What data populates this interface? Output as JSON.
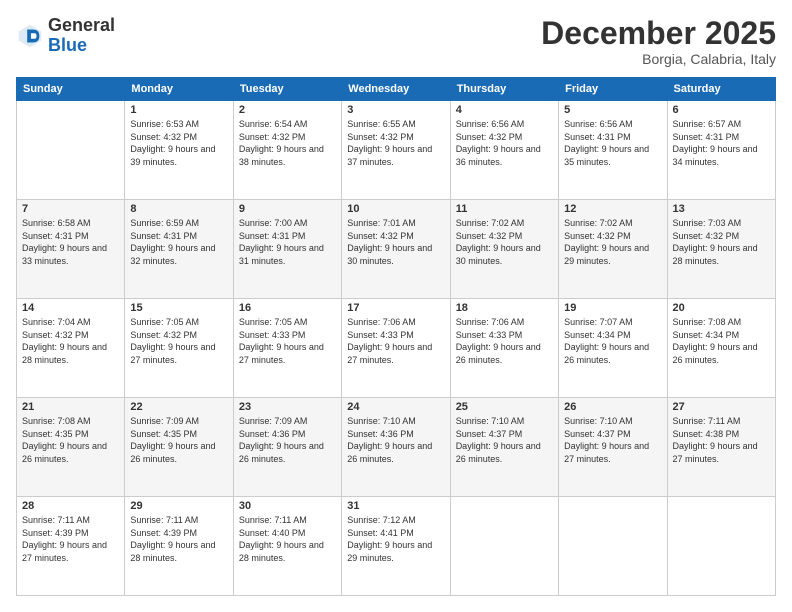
{
  "logo": {
    "general": "General",
    "blue": "Blue"
  },
  "header": {
    "month_title": "December 2025",
    "location": "Borgia, Calabria, Italy"
  },
  "weekdays": [
    "Sunday",
    "Monday",
    "Tuesday",
    "Wednesday",
    "Thursday",
    "Friday",
    "Saturday"
  ],
  "weeks": [
    [
      {
        "day": "",
        "sunrise": "",
        "sunset": "",
        "daylight": ""
      },
      {
        "day": "1",
        "sunrise": "Sunrise: 6:53 AM",
        "sunset": "Sunset: 4:32 PM",
        "daylight": "Daylight: 9 hours and 39 minutes."
      },
      {
        "day": "2",
        "sunrise": "Sunrise: 6:54 AM",
        "sunset": "Sunset: 4:32 PM",
        "daylight": "Daylight: 9 hours and 38 minutes."
      },
      {
        "day": "3",
        "sunrise": "Sunrise: 6:55 AM",
        "sunset": "Sunset: 4:32 PM",
        "daylight": "Daylight: 9 hours and 37 minutes."
      },
      {
        "day": "4",
        "sunrise": "Sunrise: 6:56 AM",
        "sunset": "Sunset: 4:32 PM",
        "daylight": "Daylight: 9 hours and 36 minutes."
      },
      {
        "day": "5",
        "sunrise": "Sunrise: 6:56 AM",
        "sunset": "Sunset: 4:31 PM",
        "daylight": "Daylight: 9 hours and 35 minutes."
      },
      {
        "day": "6",
        "sunrise": "Sunrise: 6:57 AM",
        "sunset": "Sunset: 4:31 PM",
        "daylight": "Daylight: 9 hours and 34 minutes."
      }
    ],
    [
      {
        "day": "7",
        "sunrise": "Sunrise: 6:58 AM",
        "sunset": "Sunset: 4:31 PM",
        "daylight": "Daylight: 9 hours and 33 minutes."
      },
      {
        "day": "8",
        "sunrise": "Sunrise: 6:59 AM",
        "sunset": "Sunset: 4:31 PM",
        "daylight": "Daylight: 9 hours and 32 minutes."
      },
      {
        "day": "9",
        "sunrise": "Sunrise: 7:00 AM",
        "sunset": "Sunset: 4:31 PM",
        "daylight": "Daylight: 9 hours and 31 minutes."
      },
      {
        "day": "10",
        "sunrise": "Sunrise: 7:01 AM",
        "sunset": "Sunset: 4:32 PM",
        "daylight": "Daylight: 9 hours and 30 minutes."
      },
      {
        "day": "11",
        "sunrise": "Sunrise: 7:02 AM",
        "sunset": "Sunset: 4:32 PM",
        "daylight": "Daylight: 9 hours and 30 minutes."
      },
      {
        "day": "12",
        "sunrise": "Sunrise: 7:02 AM",
        "sunset": "Sunset: 4:32 PM",
        "daylight": "Daylight: 9 hours and 29 minutes."
      },
      {
        "day": "13",
        "sunrise": "Sunrise: 7:03 AM",
        "sunset": "Sunset: 4:32 PM",
        "daylight": "Daylight: 9 hours and 28 minutes."
      }
    ],
    [
      {
        "day": "14",
        "sunrise": "Sunrise: 7:04 AM",
        "sunset": "Sunset: 4:32 PM",
        "daylight": "Daylight: 9 hours and 28 minutes."
      },
      {
        "day": "15",
        "sunrise": "Sunrise: 7:05 AM",
        "sunset": "Sunset: 4:32 PM",
        "daylight": "Daylight: 9 hours and 27 minutes."
      },
      {
        "day": "16",
        "sunrise": "Sunrise: 7:05 AM",
        "sunset": "Sunset: 4:33 PM",
        "daylight": "Daylight: 9 hours and 27 minutes."
      },
      {
        "day": "17",
        "sunrise": "Sunrise: 7:06 AM",
        "sunset": "Sunset: 4:33 PM",
        "daylight": "Daylight: 9 hours and 27 minutes."
      },
      {
        "day": "18",
        "sunrise": "Sunrise: 7:06 AM",
        "sunset": "Sunset: 4:33 PM",
        "daylight": "Daylight: 9 hours and 26 minutes."
      },
      {
        "day": "19",
        "sunrise": "Sunrise: 7:07 AM",
        "sunset": "Sunset: 4:34 PM",
        "daylight": "Daylight: 9 hours and 26 minutes."
      },
      {
        "day": "20",
        "sunrise": "Sunrise: 7:08 AM",
        "sunset": "Sunset: 4:34 PM",
        "daylight": "Daylight: 9 hours and 26 minutes."
      }
    ],
    [
      {
        "day": "21",
        "sunrise": "Sunrise: 7:08 AM",
        "sunset": "Sunset: 4:35 PM",
        "daylight": "Daylight: 9 hours and 26 minutes."
      },
      {
        "day": "22",
        "sunrise": "Sunrise: 7:09 AM",
        "sunset": "Sunset: 4:35 PM",
        "daylight": "Daylight: 9 hours and 26 minutes."
      },
      {
        "day": "23",
        "sunrise": "Sunrise: 7:09 AM",
        "sunset": "Sunset: 4:36 PM",
        "daylight": "Daylight: 9 hours and 26 minutes."
      },
      {
        "day": "24",
        "sunrise": "Sunrise: 7:10 AM",
        "sunset": "Sunset: 4:36 PM",
        "daylight": "Daylight: 9 hours and 26 minutes."
      },
      {
        "day": "25",
        "sunrise": "Sunrise: 7:10 AM",
        "sunset": "Sunset: 4:37 PM",
        "daylight": "Daylight: 9 hours and 26 minutes."
      },
      {
        "day": "26",
        "sunrise": "Sunrise: 7:10 AM",
        "sunset": "Sunset: 4:37 PM",
        "daylight": "Daylight: 9 hours and 27 minutes."
      },
      {
        "day": "27",
        "sunrise": "Sunrise: 7:11 AM",
        "sunset": "Sunset: 4:38 PM",
        "daylight": "Daylight: 9 hours and 27 minutes."
      }
    ],
    [
      {
        "day": "28",
        "sunrise": "Sunrise: 7:11 AM",
        "sunset": "Sunset: 4:39 PM",
        "daylight": "Daylight: 9 hours and 27 minutes."
      },
      {
        "day": "29",
        "sunrise": "Sunrise: 7:11 AM",
        "sunset": "Sunset: 4:39 PM",
        "daylight": "Daylight: 9 hours and 28 minutes."
      },
      {
        "day": "30",
        "sunrise": "Sunrise: 7:11 AM",
        "sunset": "Sunset: 4:40 PM",
        "daylight": "Daylight: 9 hours and 28 minutes."
      },
      {
        "day": "31",
        "sunrise": "Sunrise: 7:12 AM",
        "sunset": "Sunset: 4:41 PM",
        "daylight": "Daylight: 9 hours and 29 minutes."
      },
      {
        "day": "",
        "sunrise": "",
        "sunset": "",
        "daylight": ""
      },
      {
        "day": "",
        "sunrise": "",
        "sunset": "",
        "daylight": ""
      },
      {
        "day": "",
        "sunrise": "",
        "sunset": "",
        "daylight": ""
      }
    ]
  ]
}
